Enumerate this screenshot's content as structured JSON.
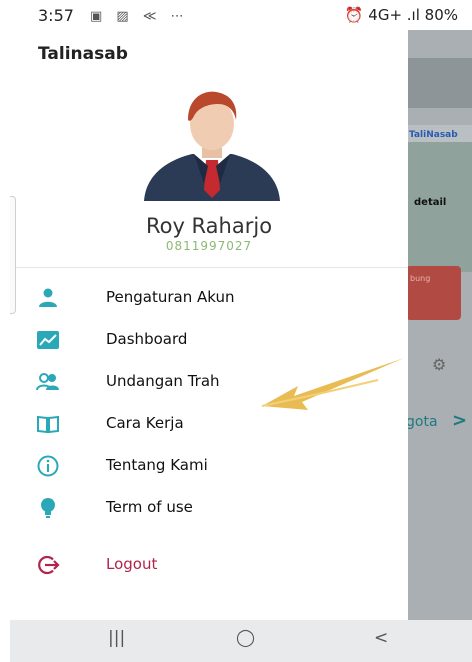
{
  "status_bar": {
    "time": "3:57",
    "left_icons": "▣ ▨ ≪ ⋯",
    "right": "⏰ 4G+ .ıl 80%"
  },
  "drawer": {
    "title": "Talinasab",
    "profile": {
      "name": "Roy Raharjo",
      "phone": "0811997027"
    },
    "menu": [
      {
        "label": "Pengaturan Akun",
        "icon": "person-icon"
      },
      {
        "label": "Dashboard",
        "icon": "chart-icon"
      },
      {
        "label": "Undangan Trah",
        "icon": "people-icon"
      },
      {
        "label": "Cara Kerja",
        "icon": "book-icon"
      },
      {
        "label": "Tentang Kami",
        "icon": "info-icon"
      },
      {
        "label": "Term of use",
        "icon": "bulb-icon"
      }
    ],
    "logout": {
      "label": "Logout",
      "icon": "logout-icon"
    }
  },
  "background": {
    "brand": "TaliNasab",
    "detail": "detail",
    "card_label": "bung",
    "anggota": "gota",
    "anggota_chevron": ">"
  },
  "nav": {
    "recents": "|||",
    "home": "◯",
    "back": "<"
  },
  "colors": {
    "accent": "#2aa8b8",
    "logout": "#b0244e",
    "phone_text": "#8db874",
    "arrow": "#e8b84a"
  }
}
